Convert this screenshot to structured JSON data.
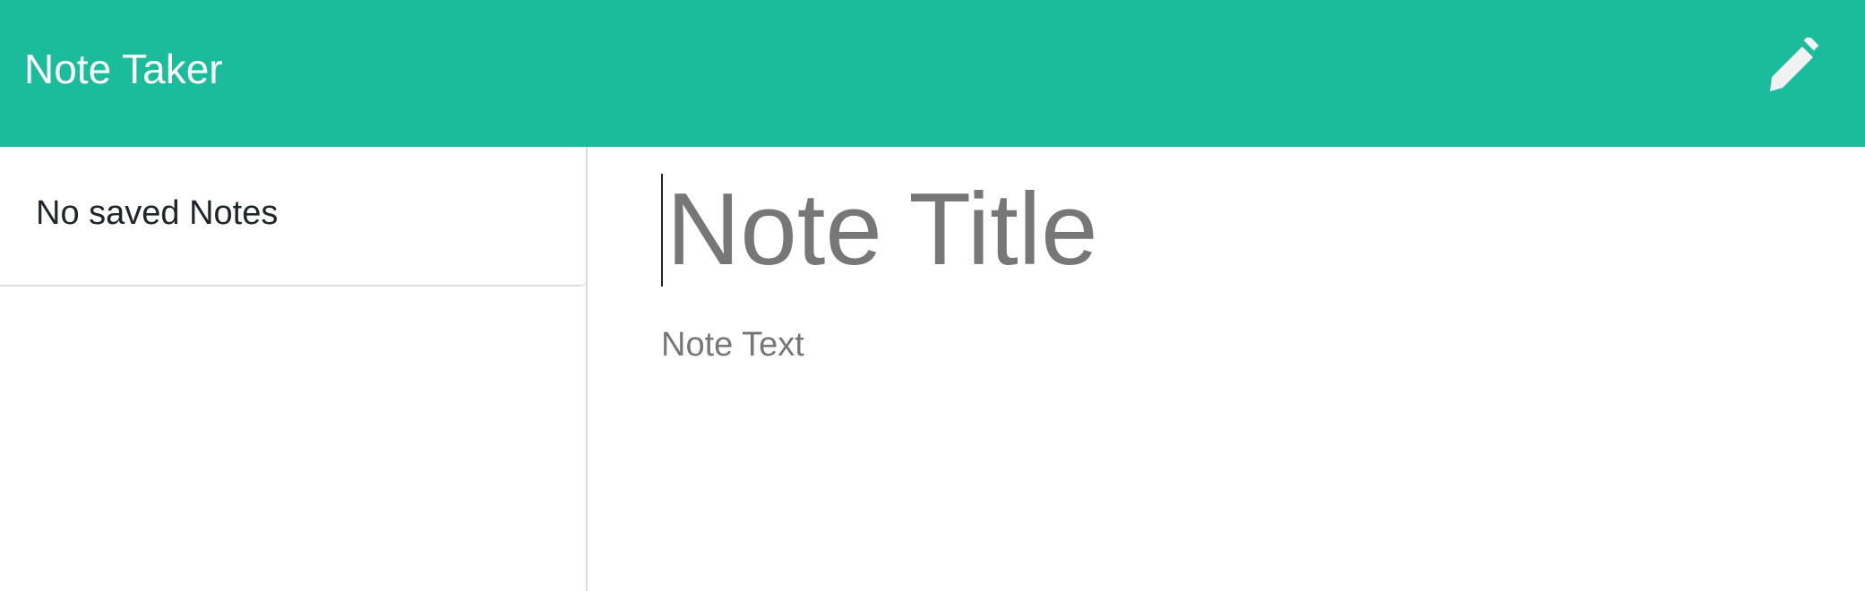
{
  "app": {
    "brand": "Note Taker",
    "new_note_icon": "pencil-icon"
  },
  "sidebar": {
    "empty_message": "No saved Notes"
  },
  "editor": {
    "title_placeholder": "Note Title",
    "title_value": "",
    "text_placeholder": "Note Text",
    "text_value": ""
  },
  "colors": {
    "navbar": "#1abc9c",
    "brand_text": "#ffffff",
    "icon": "#ffffff",
    "placeholder": "#777777",
    "divider": "#dcdcdc"
  }
}
